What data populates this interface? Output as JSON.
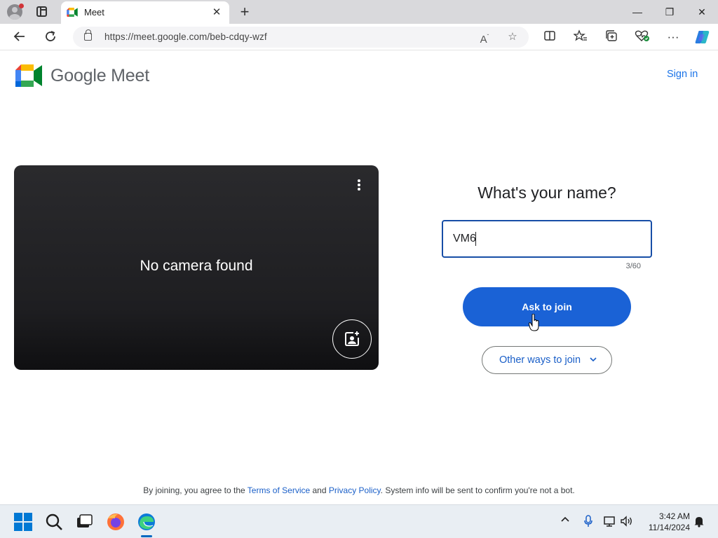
{
  "browser": {
    "tab_title": "Meet",
    "tab_close": "✕",
    "new_tab": "+",
    "url": "https://meet.google.com/beb-cdqy-wzf",
    "window_controls": {
      "minimize": "—",
      "restore": "❐",
      "close": "✕"
    }
  },
  "header": {
    "brand": "Google Meet",
    "sign_in": "Sign in"
  },
  "preview": {
    "message": "No camera found"
  },
  "join": {
    "question": "What's your name?",
    "name_value": "VM6",
    "char_count": "3/60",
    "ask_button": "Ask to join",
    "other_ways": "Other ways to join"
  },
  "footer": {
    "prefix": "By joining, you agree to the",
    "terms": "Terms of Service",
    "and": "and",
    "privacy": "Privacy Policy",
    "suffix": ". System info will be sent to confirm you're not a bot."
  },
  "taskbar": {
    "time": "3:42 AM",
    "date": "11/14/2024"
  },
  "colors": {
    "meet_blue": "#1a73e8",
    "ask_button": "#1a62d6",
    "field_border": "#174ea6",
    "preview_bg": "#202124"
  }
}
